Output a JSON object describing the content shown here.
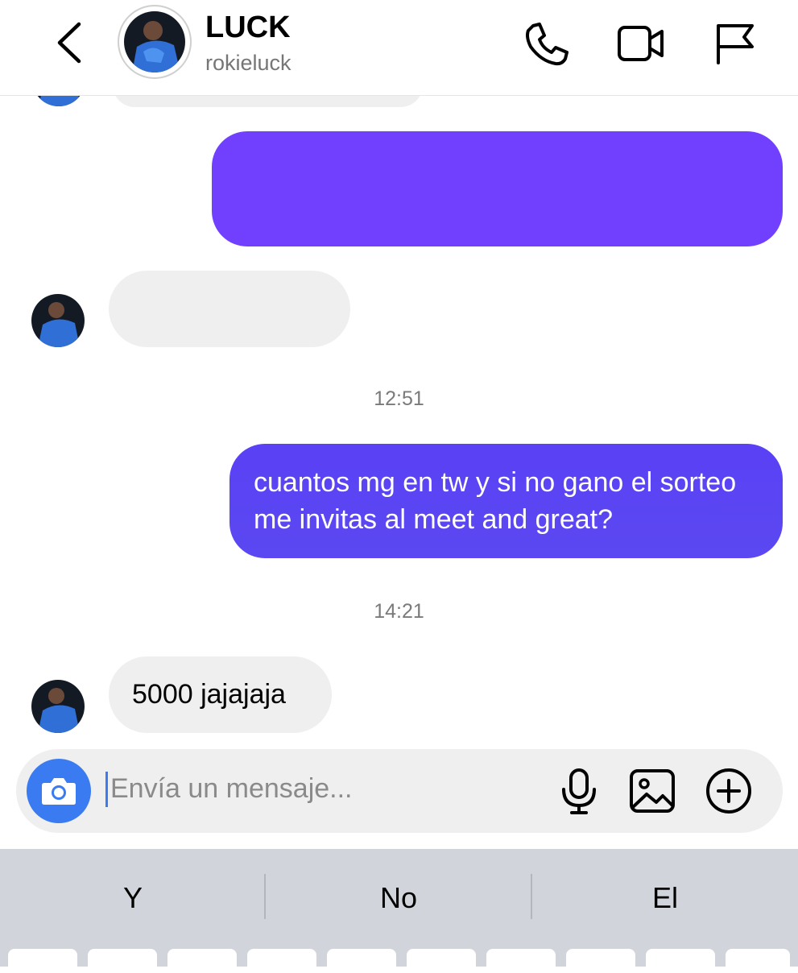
{
  "header": {
    "contact_name": "LUCK",
    "username": "rokieluck",
    "icons": [
      "back-chevron-icon",
      "phone-icon",
      "video-camera-icon",
      "flag-icon"
    ]
  },
  "conversation": {
    "timestamps": [
      "12:51",
      "14:21"
    ],
    "outgoing_message": "cuantos mg en tw y si no gano el sorteo me invitas al meet and great?",
    "incoming_reply": "5000 jajajaja"
  },
  "composer": {
    "placeholder": "Envía un mensaje...",
    "icons": [
      "camera-icon",
      "microphone-icon",
      "image-icon",
      "add-circle-icon"
    ]
  },
  "keyboard": {
    "suggestions": [
      "Y",
      "No",
      "El"
    ]
  },
  "colors": {
    "outgoing_bubble": "#6a3cff",
    "incoming_bubble": "#efefef",
    "camera_button": "#3a7bf2",
    "keyboard_bg": "#d1d4da"
  }
}
